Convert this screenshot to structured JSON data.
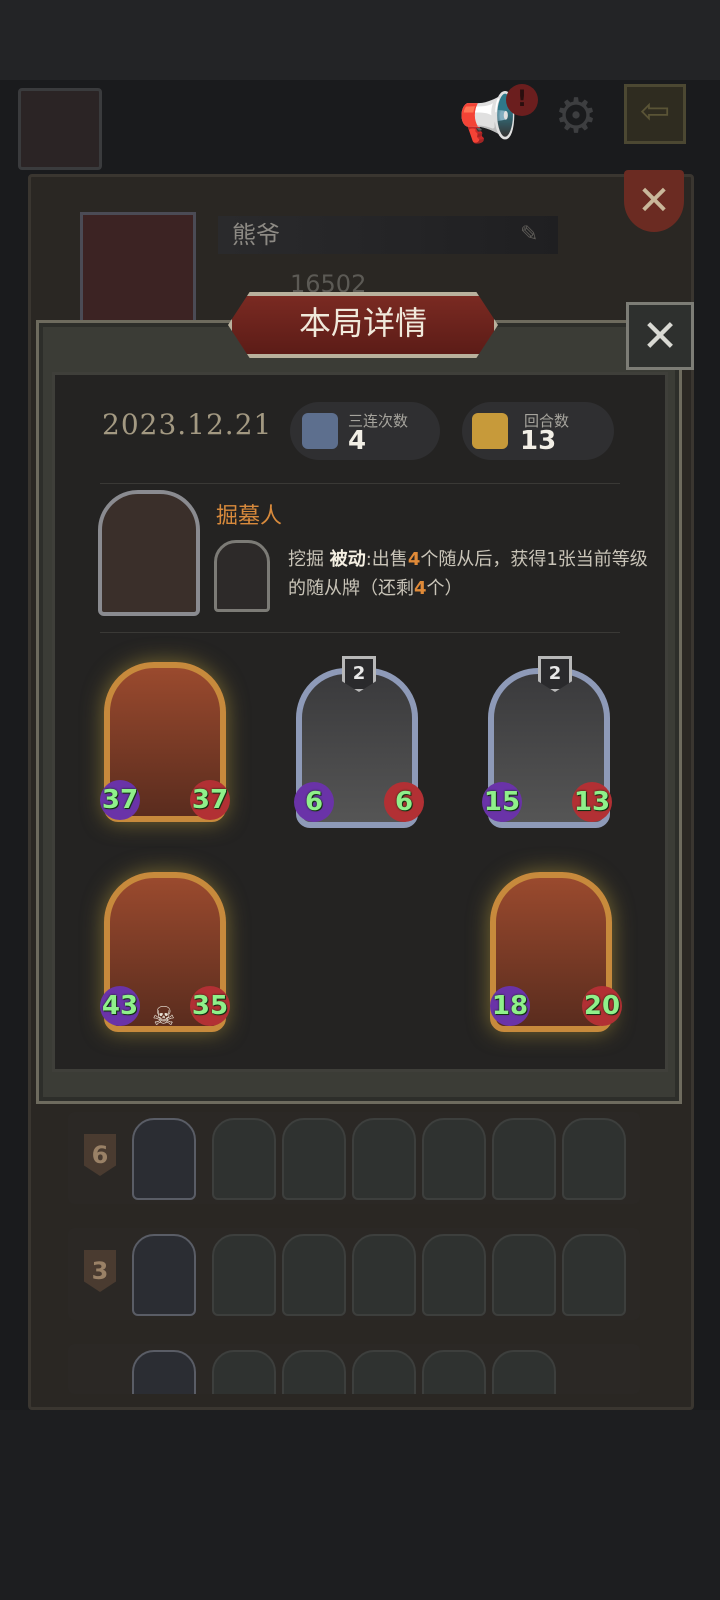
{
  "background": {
    "player_name": "熊爷",
    "score": "16502"
  },
  "modal": {
    "title": "本局详情",
    "date": "2023.12.21",
    "stats": [
      {
        "label": "三连次数",
        "value": "4",
        "icon": "triple-icon"
      },
      {
        "label": "回合数",
        "value": "13",
        "icon": "rounds-icon"
      }
    ],
    "hero": {
      "name": "掘墓人",
      "skill_name": "挖掘",
      "skill_type": "被动",
      "skill_desc_1": ":出售",
      "skill_num_1": "4",
      "skill_desc_2": "个随从后，获得1张当前等级的随从牌（还剩",
      "skill_num_2": "4",
      "skill_desc_3": "个）"
    },
    "minions": [
      {
        "attack": "37",
        "health": "37",
        "tier": "",
        "frame": "gold"
      },
      {
        "attack": "6",
        "health": "6",
        "tier": "2",
        "frame": "silver"
      },
      {
        "attack": "15",
        "health": "13",
        "tier": "2",
        "frame": "silver"
      },
      {
        "attack": "43",
        "health": "35",
        "tier": "",
        "frame": "gold"
      },
      {
        "attack": "18",
        "health": "20",
        "tier": "",
        "frame": "gold"
      }
    ]
  },
  "history": [
    {
      "rank": "6"
    },
    {
      "rank": "3"
    }
  ],
  "colors": {
    "accent_orange": "#d88a3c",
    "modal_bg": "#242322",
    "stat_green": "#8ff08a"
  }
}
